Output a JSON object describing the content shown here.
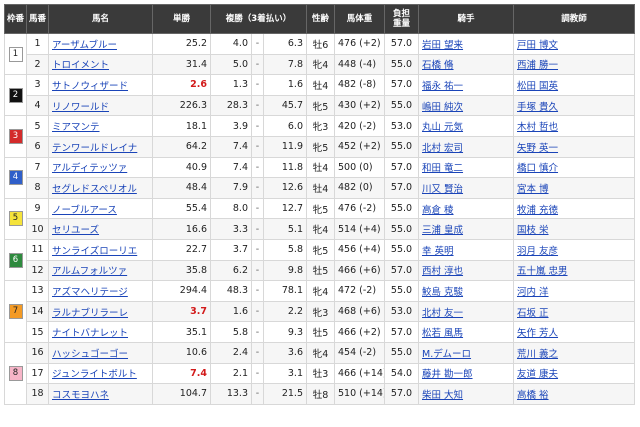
{
  "headers": {
    "waku": "枠番",
    "umaban": "馬番",
    "name": "馬名",
    "win": "単勝",
    "place": "複勝（3着払い）",
    "sexage": "性齢",
    "weight": "馬体重",
    "burden": "負担\n重量",
    "jockey": "騎手",
    "trainer": "調教師"
  },
  "waku_groups": [
    {
      "label": "1",
      "rows": 2,
      "bg": "#ffffff",
      "fg": "#222222"
    },
    {
      "label": "2",
      "rows": 2,
      "bg": "#111111",
      "fg": "#ffffff"
    },
    {
      "label": "3",
      "rows": 2,
      "bg": "#d32b2b",
      "fg": "#ffffff"
    },
    {
      "label": "4",
      "rows": 2,
      "bg": "#2f5fc9",
      "fg": "#ffffff"
    },
    {
      "label": "5",
      "rows": 2,
      "bg": "#f5e33b",
      "fg": "#222222"
    },
    {
      "label": "6",
      "rows": 2,
      "bg": "#2e8a3e",
      "fg": "#ffffff"
    },
    {
      "label": "7",
      "rows": 3,
      "bg": "#f39a25",
      "fg": "#222222"
    },
    {
      "label": "8",
      "rows": 3,
      "bg": "#f7b5c8",
      "fg": "#222222"
    }
  ],
  "horses": [
    {
      "no": "1",
      "name": "アーザムブルー",
      "win": "25.2",
      "pmin": "4.0",
      "pmax": "6.3",
      "sexage": "牡6",
      "weight": "476 (+2)",
      "burden": "57.0",
      "jockey": "岩田 望来",
      "trainer": "戸田 博文",
      "fav": false
    },
    {
      "no": "2",
      "name": "トロイメント",
      "win": "31.4",
      "pmin": "5.0",
      "pmax": "7.8",
      "sexage": "牝4",
      "weight": "448 (-4)",
      "burden": "55.0",
      "jockey": "石橋 脩",
      "trainer": "西浦 勝一",
      "fav": false
    },
    {
      "no": "3",
      "name": "サトノウィザード",
      "win": "2.6",
      "pmin": "1.3",
      "pmax": "1.6",
      "sexage": "牡4",
      "weight": "482 (-8)",
      "burden": "57.0",
      "jockey": "福永 祐一",
      "trainer": "松田 国英",
      "fav": true
    },
    {
      "no": "4",
      "name": "リノワールド",
      "win": "226.3",
      "pmin": "28.3",
      "pmax": "45.7",
      "sexage": "牝5",
      "weight": "430 (+2)",
      "burden": "55.0",
      "jockey": "嶋田 純次",
      "trainer": "手塚 貴久",
      "fav": false
    },
    {
      "no": "5",
      "name": "ミアマンテ",
      "win": "18.1",
      "pmin": "3.9",
      "pmax": "6.0",
      "sexage": "牝3",
      "weight": "420 (-2)",
      "burden": "53.0",
      "jockey": "丸山 元気",
      "trainer": "木村 哲也",
      "fav": false
    },
    {
      "no": "6",
      "name": "テンワールドレイナ",
      "win": "64.2",
      "pmin": "7.4",
      "pmax": "11.9",
      "sexage": "牝5",
      "weight": "452 (+2)",
      "burden": "55.0",
      "jockey": "北村 宏司",
      "trainer": "矢野 英一",
      "fav": false
    },
    {
      "no": "7",
      "name": "アルディテッツァ",
      "win": "40.9",
      "pmin": "7.4",
      "pmax": "11.8",
      "sexage": "牡4",
      "weight": "500 (0)",
      "burden": "57.0",
      "jockey": "和田 竜二",
      "trainer": "橋口 慎介",
      "fav": false
    },
    {
      "no": "8",
      "name": "セグレドスペリオル",
      "win": "48.4",
      "pmin": "7.9",
      "pmax": "12.6",
      "sexage": "牡4",
      "weight": "482 (0)",
      "burden": "57.0",
      "jockey": "川又 賢治",
      "trainer": "宮本 博",
      "fav": false
    },
    {
      "no": "9",
      "name": "ノーブルアース",
      "win": "55.4",
      "pmin": "8.0",
      "pmax": "12.7",
      "sexage": "牝5",
      "weight": "476 (-2)",
      "burden": "55.0",
      "jockey": "高倉 稜",
      "trainer": "牧浦 充徳",
      "fav": false
    },
    {
      "no": "10",
      "name": "セリユーズ",
      "win": "16.6",
      "pmin": "3.3",
      "pmax": "5.1",
      "sexage": "牝4",
      "weight": "514 (+4)",
      "burden": "55.0",
      "jockey": "三浦 皇成",
      "trainer": "国枝 栄",
      "fav": false
    },
    {
      "no": "11",
      "name": "サンライズローリエ",
      "win": "22.7",
      "pmin": "3.7",
      "pmax": "5.8",
      "sexage": "牝5",
      "weight": "456 (+4)",
      "burden": "55.0",
      "jockey": "幸 英明",
      "trainer": "羽月 友彦",
      "fav": false
    },
    {
      "no": "12",
      "name": "アルムフォルツァ",
      "win": "35.8",
      "pmin": "6.2",
      "pmax": "9.8",
      "sexage": "牡5",
      "weight": "466 (+6)",
      "burden": "57.0",
      "jockey": "西村 淳也",
      "trainer": "五十嵐 忠男",
      "fav": false
    },
    {
      "no": "13",
      "name": "アズマヘリテージ",
      "win": "294.4",
      "pmin": "48.3",
      "pmax": "78.1",
      "sexage": "牝4",
      "weight": "472 (-2)",
      "burden": "55.0",
      "jockey": "鮫島 克駿",
      "trainer": "河内 洋",
      "fav": false
    },
    {
      "no": "14",
      "name": "ラルナブリラーレ",
      "win": "3.7",
      "pmin": "1.6",
      "pmax": "2.2",
      "sexage": "牝3",
      "weight": "468 (+6)",
      "burden": "53.0",
      "jockey": "北村 友一",
      "trainer": "石坂 正",
      "fav": true
    },
    {
      "no": "15",
      "name": "ナイトバナレット",
      "win": "35.1",
      "pmin": "5.8",
      "pmax": "9.3",
      "sexage": "牡5",
      "weight": "466 (+2)",
      "burden": "57.0",
      "jockey": "松若 風馬",
      "trainer": "矢作 芳人",
      "fav": false
    },
    {
      "no": "16",
      "name": "ハッシュゴーゴー",
      "win": "10.6",
      "pmin": "2.4",
      "pmax": "3.6",
      "sexage": "牝4",
      "weight": "454 (-2)",
      "burden": "55.0",
      "jockey": "M.デムーロ",
      "trainer": "荒川 義之",
      "fav": false
    },
    {
      "no": "17",
      "name": "ジュンライトボルト",
      "win": "7.4",
      "pmin": "2.1",
      "pmax": "3.1",
      "sexage": "牡3",
      "weight": "466 (+14)",
      "burden": "54.0",
      "jockey": "藤井 勘一郎",
      "trainer": "友道 康夫",
      "fav": true
    },
    {
      "no": "18",
      "name": "コスモヨハネ",
      "win": "104.7",
      "pmin": "13.3",
      "pmax": "21.5",
      "sexage": "牡8",
      "weight": "510 (+14)",
      "burden": "57.0",
      "jockey": "柴田 大知",
      "trainer": "高橋 裕",
      "fav": false
    }
  ]
}
